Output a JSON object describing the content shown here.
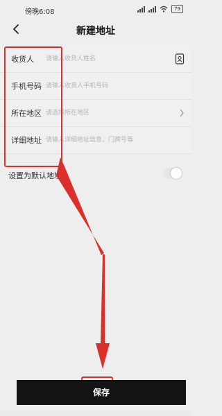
{
  "status": {
    "time": "傍晚6:08",
    "battery": "79"
  },
  "header": {
    "title": "新建地址"
  },
  "form": {
    "rows": [
      {
        "label": "收货人",
        "placeholder": "请输入收货人姓名"
      },
      {
        "label": "手机号码",
        "placeholder": "请输入收货人手机号码"
      },
      {
        "label": "所在地区",
        "placeholder": "请选择所在地区"
      },
      {
        "label": "详细地址",
        "placeholder": "请输入详细地址信息，门牌号等"
      }
    ]
  },
  "default_address": {
    "label": "设置为默认地址",
    "enabled": false
  },
  "save_button": {
    "label": "保存"
  },
  "colors": {
    "annotation": "#d9302b",
    "button_bg": "#141414"
  },
  "icons": [
    "back-icon",
    "contact-book-icon",
    "chevron-right-icon",
    "wifi-icon",
    "signal-icon",
    "battery-icon"
  ]
}
